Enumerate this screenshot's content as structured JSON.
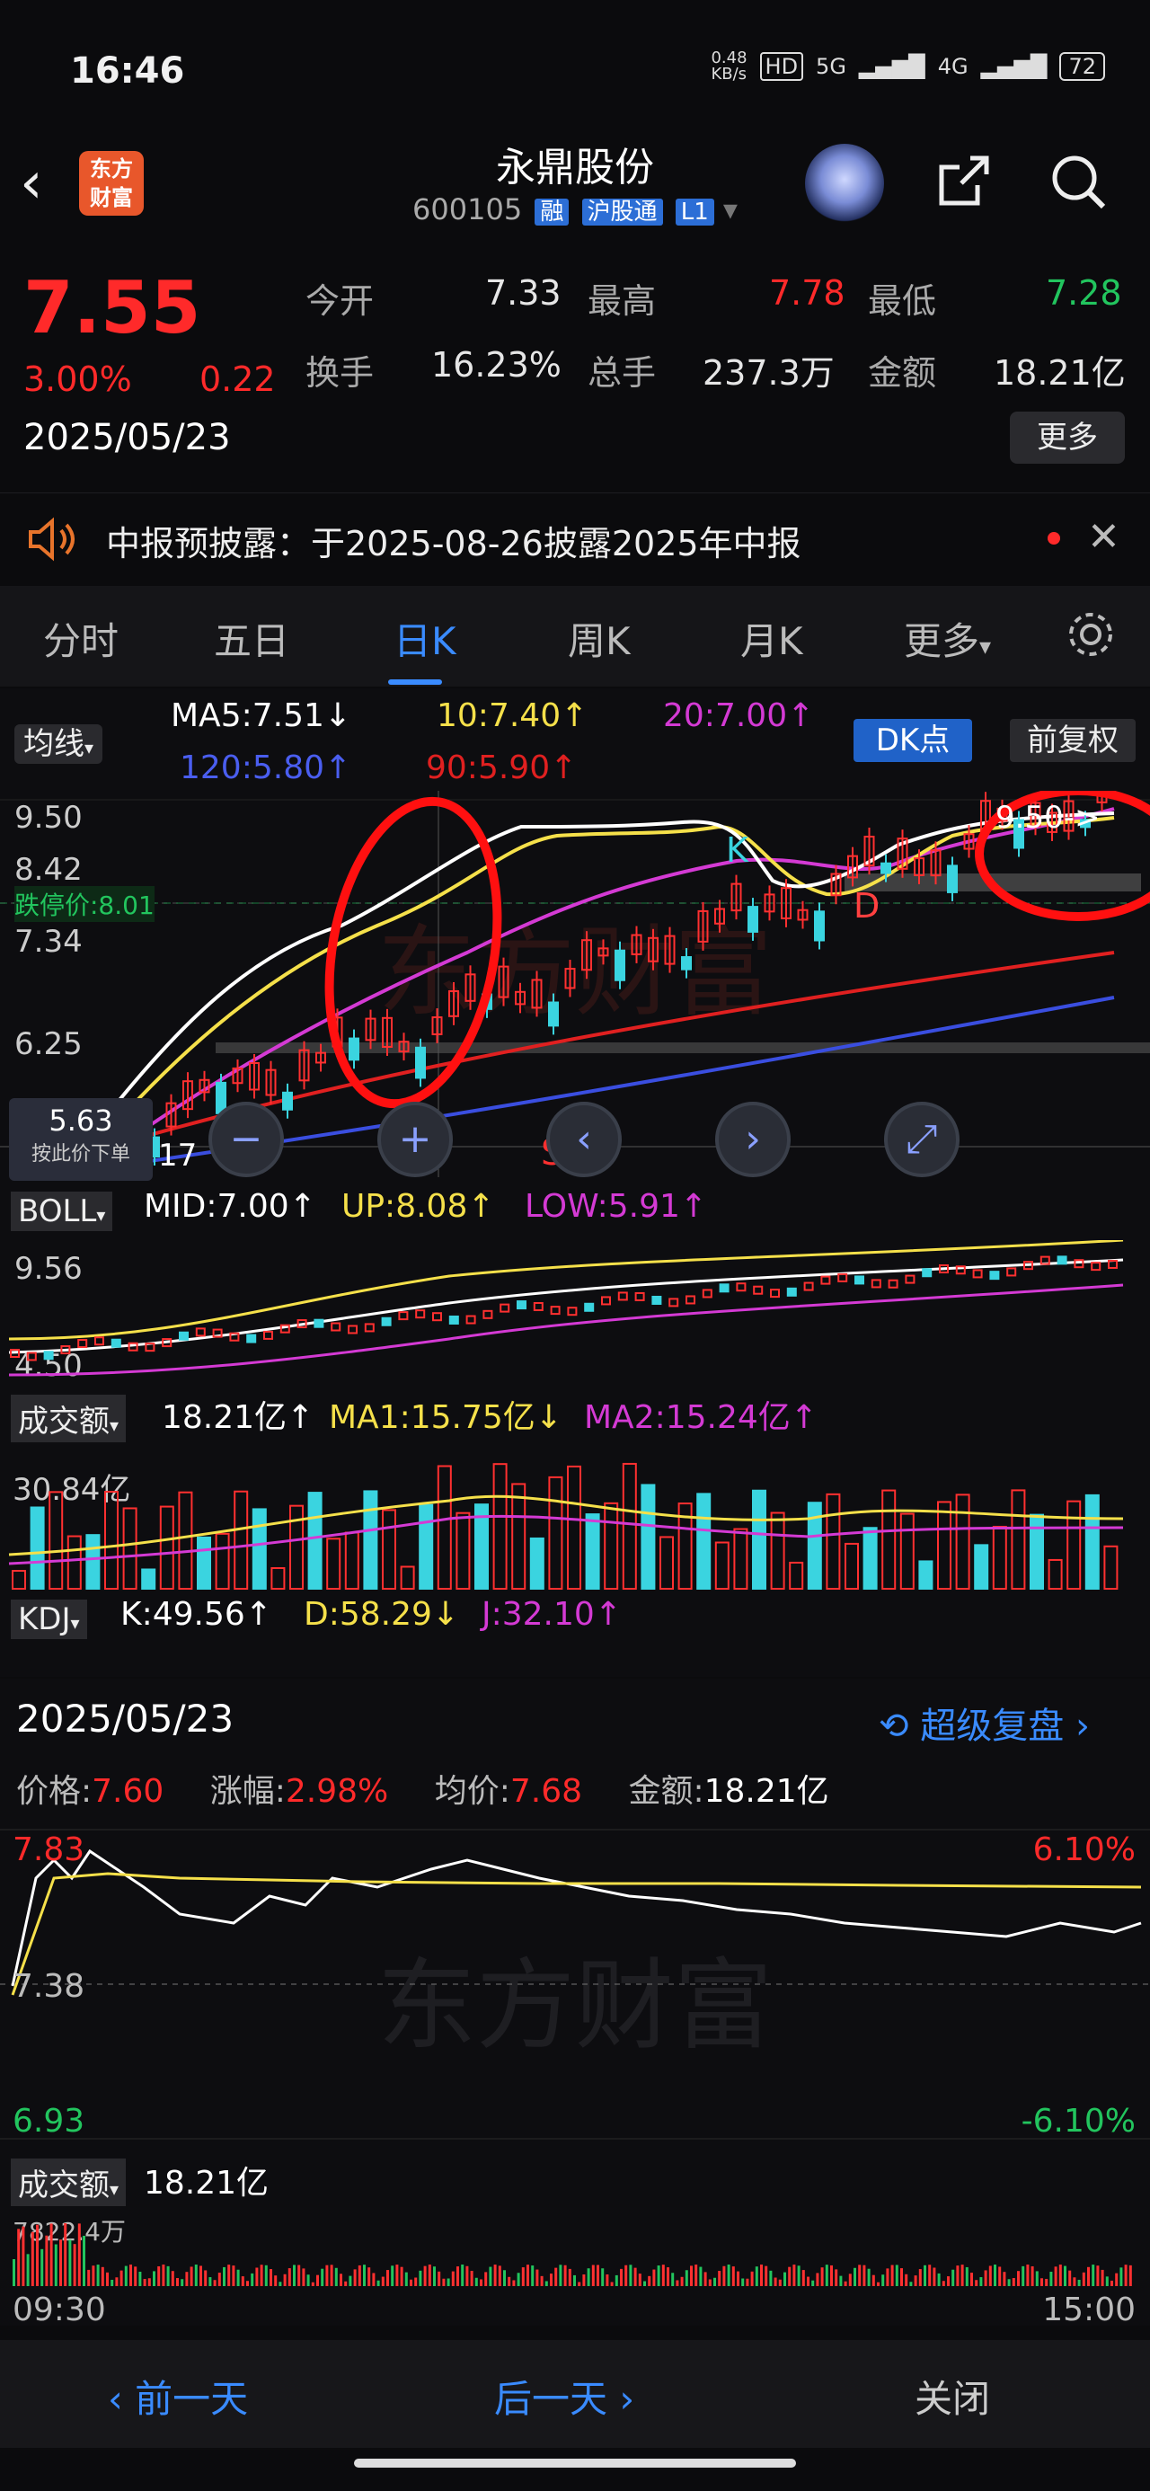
{
  "status_bar": {
    "time": "16:46",
    "net_speed": "0.48\nKB/s",
    "hd": "HD",
    "sig1": "5G",
    "sig2": "4G",
    "battery": "72"
  },
  "header": {
    "logo_text": "东方\n财富",
    "name": "永鼎股份",
    "code": "600105",
    "tags": [
      "融",
      "沪股通",
      "L1"
    ]
  },
  "quote": {
    "price": "7.55",
    "pct": "3.00%",
    "change": "0.22",
    "date": "2025/05/23",
    "fields": [
      {
        "label": "今开",
        "value": "7.33",
        "color": "#ffffff"
      },
      {
        "label": "最高",
        "value": "7.78",
        "color": "#ff2a2a"
      },
      {
        "label": "最低",
        "value": "7.28",
        "color": "#22c55e"
      },
      {
        "label": "换手",
        "value": "16.23%",
        "color": "#ffffff"
      },
      {
        "label": "总手",
        "value": "237.3万",
        "color": "#ffffff"
      },
      {
        "label": "金额",
        "value": "18.21亿",
        "color": "#ffffff"
      }
    ],
    "more_label": "更多"
  },
  "notice": {
    "text": "中报预披露：于2025-08-26披露2025年中报"
  },
  "tabs": [
    {
      "label": "分时"
    },
    {
      "label": "五日"
    },
    {
      "label": "日K",
      "active": true
    },
    {
      "label": "周K"
    },
    {
      "label": "月K"
    },
    {
      "label": "更多"
    }
  ],
  "kline": {
    "ma_selector": "均线",
    "ma5": "MA5:7.51",
    "ma10": "10:7.40",
    "ma20": "20:7.00",
    "ma120": "120:5.80",
    "ma90": "90:5.90",
    "dk_label": "DK点",
    "fuquan_label": "前复权",
    "axis": [
      "9.50",
      "8.42",
      "7.34",
      "6.25"
    ],
    "limit_down": "跌停价:8.01",
    "cursor_price": "5.63",
    "cursor_hint": "按此价下单",
    "cursor_day": "17",
    "marker_k": "K",
    "marker_d": "D",
    "marker_s": "S",
    "right_label": "9.50->"
  },
  "boll": {
    "selector": "BOLL",
    "mid": "MID:7.00",
    "up": "UP:8.08",
    "low": "LOW:5.91",
    "top": "9.56",
    "bottom": "4.50"
  },
  "volume": {
    "selector": "成交额",
    "total": "18.21亿",
    "ma1": "MA1:15.75亿",
    "ma2": "MA2:15.24亿",
    "top": "30.84亿"
  },
  "kdj": {
    "selector": "KDJ",
    "k": "K:49.56",
    "d": "D:58.29",
    "j": "J:32.10"
  },
  "intraday": {
    "date": "2025/05/23",
    "replay": "超级复盘",
    "price_label": "价格:",
    "price": "7.60",
    "pct_label": "涨幅:",
    "pct": "2.98%",
    "avg_label": "均价:",
    "avg": "7.68",
    "amt_label": "金额:",
    "amt": "18.21亿",
    "y_top": "7.83",
    "y_mid": "7.38",
    "y_bot": "6.93",
    "r_top": "6.10%",
    "r_bot": "-6.10%",
    "vol_selector": "成交额",
    "vol_total": "18.21亿",
    "vol_max": "7822.4万",
    "t_start": "09:30",
    "t_end": "15:00"
  },
  "bottom": {
    "prev": "前一天",
    "next": "后一天",
    "close": "关闭"
  },
  "watermark": "东方财富",
  "colors": {
    "up": "#ff2a2a",
    "down": "#22c55e",
    "accent": "#2c6ed6",
    "ma5": "#ffffff",
    "ma10": "#f5e04a",
    "ma20": "#d43ad4",
    "ma90": "#e02020",
    "ma120": "#3a4ee0"
  }
}
